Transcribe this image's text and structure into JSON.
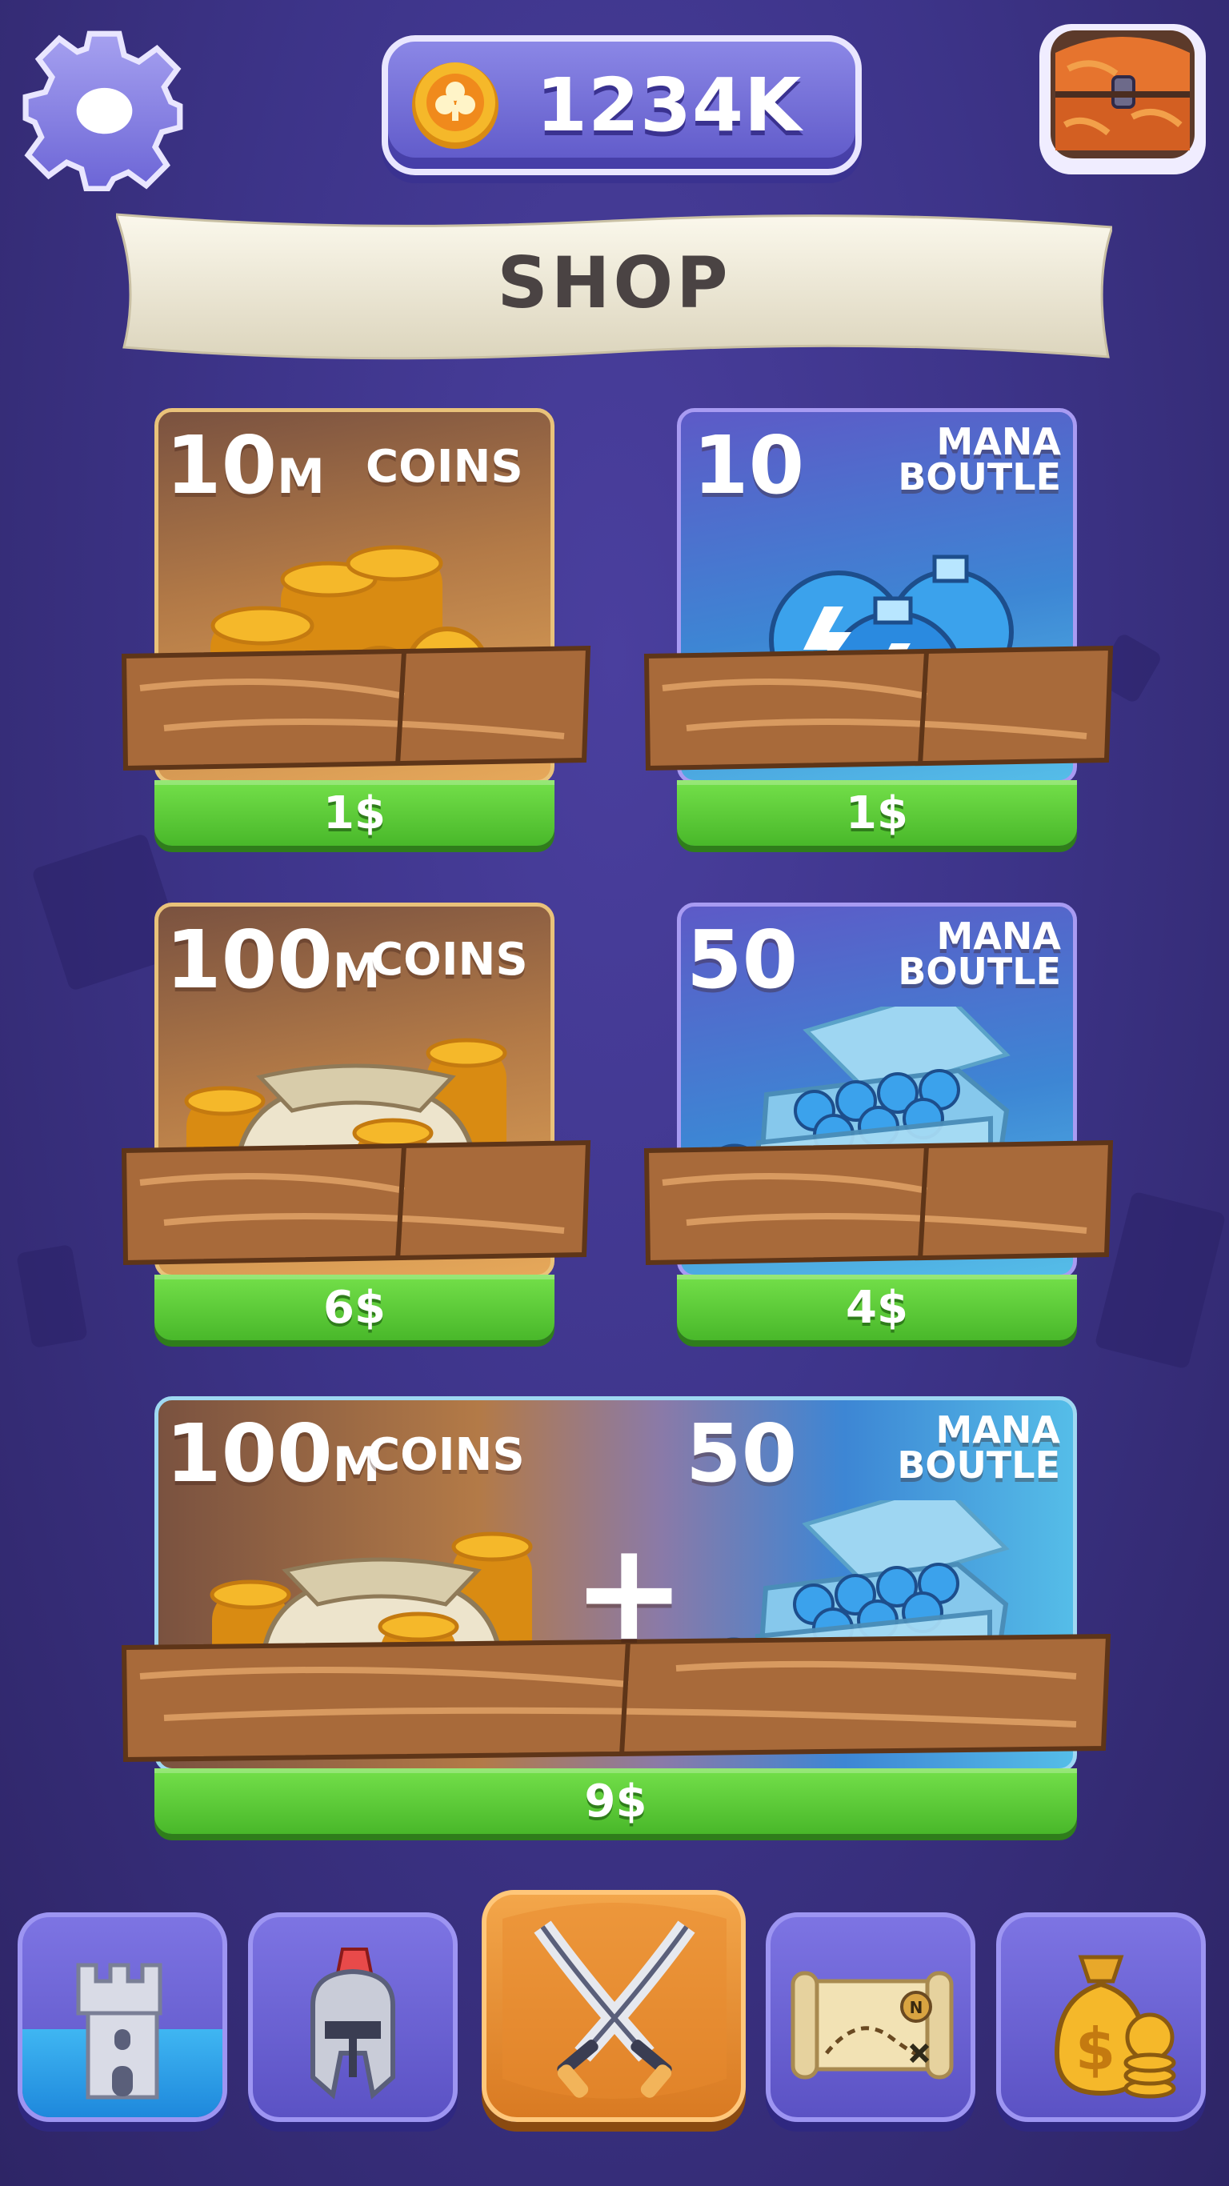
{
  "header": {
    "currency_amount": "1234K",
    "currency_icon": "coin-icon",
    "settings_icon": "gear-icon",
    "chest_icon": "treasure-chest-icon"
  },
  "banner": {
    "title": "SHOP"
  },
  "offers": [
    {
      "amount": "10",
      "unit": "M",
      "name": "COINS",
      "price": "1$",
      "icon": "coin-stack-icon"
    },
    {
      "amount": "10",
      "name_line1": "MANA",
      "name_line2": "BOUTLE",
      "price": "1$",
      "icon": "mana-potions-icon"
    },
    {
      "amount": "100",
      "unit": "M",
      "name": "COINS",
      "price": "6$",
      "icon": "coin-bag-icon"
    },
    {
      "amount": "50",
      "name_line1": "MANA",
      "name_line2": "BOUTLE",
      "price": "4$",
      "icon": "potion-crate-icon"
    }
  ],
  "bundle": {
    "coins_amount": "100",
    "coins_unit": "M",
    "coins_name": "COINS",
    "plus": "+",
    "mana_amount": "50",
    "mana_line1": "MANA",
    "mana_line2": "BOUTLE",
    "price": "9$"
  },
  "nav": [
    {
      "id": "castle",
      "icon": "castle-tower-icon",
      "active": false
    },
    {
      "id": "heroes",
      "icon": "knight-helmet-icon",
      "active": false
    },
    {
      "id": "battle",
      "icon": "crossed-swords-icon",
      "active": true
    },
    {
      "id": "map",
      "icon": "treasure-map-icon",
      "active": false
    },
    {
      "id": "shop",
      "icon": "money-bag-icon",
      "active": false
    }
  ],
  "colors": {
    "background": "#3d3489",
    "price_green": "#5acb34",
    "coin_gold": "#f5b82a",
    "mana_blue": "#3d86d4",
    "active_tab": "#e68d2e"
  }
}
